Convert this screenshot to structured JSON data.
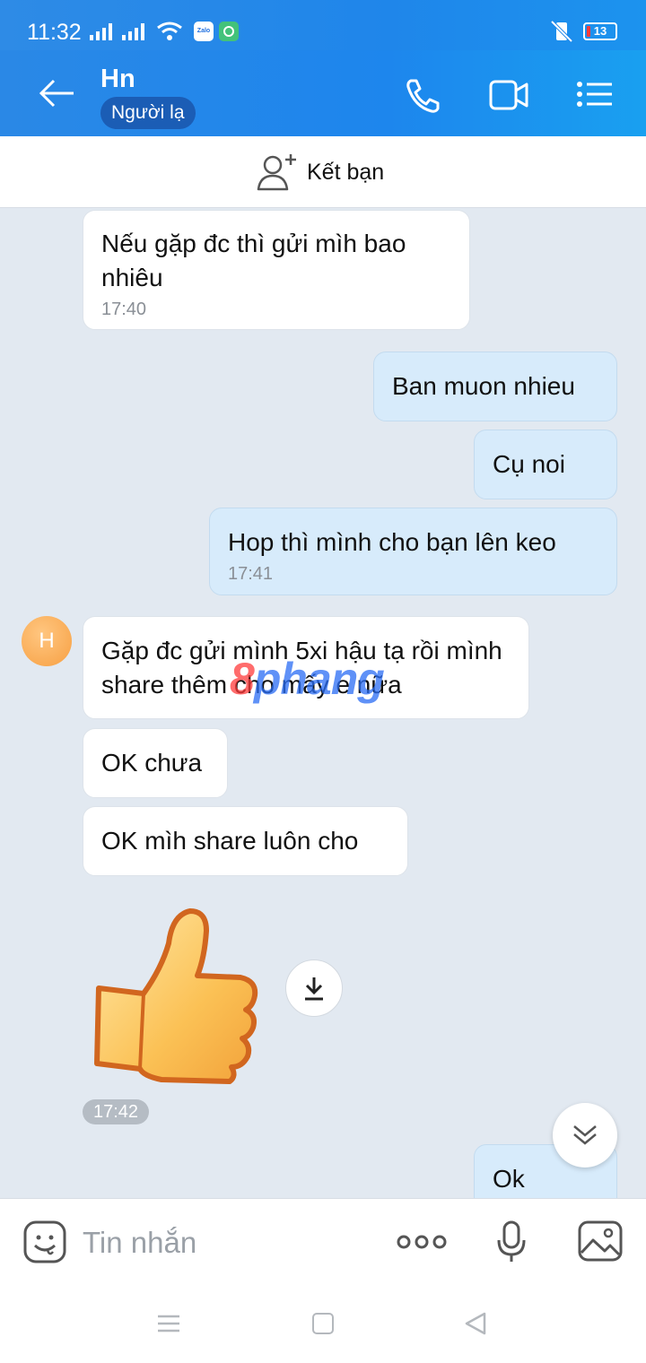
{
  "status_bar": {
    "time": "11:32",
    "zalo_label": "Zalo",
    "battery": "13"
  },
  "header": {
    "contact_name": "Hn",
    "badge": "Người lạ",
    "color": "#1f86ea"
  },
  "friend_bar": {
    "label": "Kết bạn"
  },
  "messages": [
    {
      "side": "in",
      "text": "Nếu gặp đc thì gửi mìh bao nhiêu",
      "time": "17:40"
    },
    {
      "side": "out",
      "text": "Ban muon nhieu",
      "time": ""
    },
    {
      "side": "out",
      "text": "Cụ noi",
      "time": ""
    },
    {
      "side": "out",
      "text": "Hop thì mình cho bạn lên keo",
      "time": "17:41"
    },
    {
      "side": "in",
      "text": "Gặp đc gửi mình 5xi hậu tạ rồi mình share thêm cho mấy e nữa",
      "time": ""
    },
    {
      "side": "in",
      "text": "OK chưa",
      "time": ""
    },
    {
      "side": "in",
      "text": "OK mìh share luôn cho",
      "time": ""
    },
    {
      "side": "out",
      "text": "Ok",
      "time": ""
    }
  ],
  "avatar_initial": "H",
  "sticker": {
    "icon": "thumbs-up-sticker",
    "time": "17:42"
  },
  "watermark": {
    "part1": "8",
    "part2": "phang"
  },
  "input_bar": {
    "placeholder": "Tin nhắn"
  },
  "colors": {
    "accent": "#1f86ea",
    "bubble_out": "#d7ebfb",
    "bubble_in": "#ffffff",
    "chat_bg": "#e2e9f1"
  }
}
